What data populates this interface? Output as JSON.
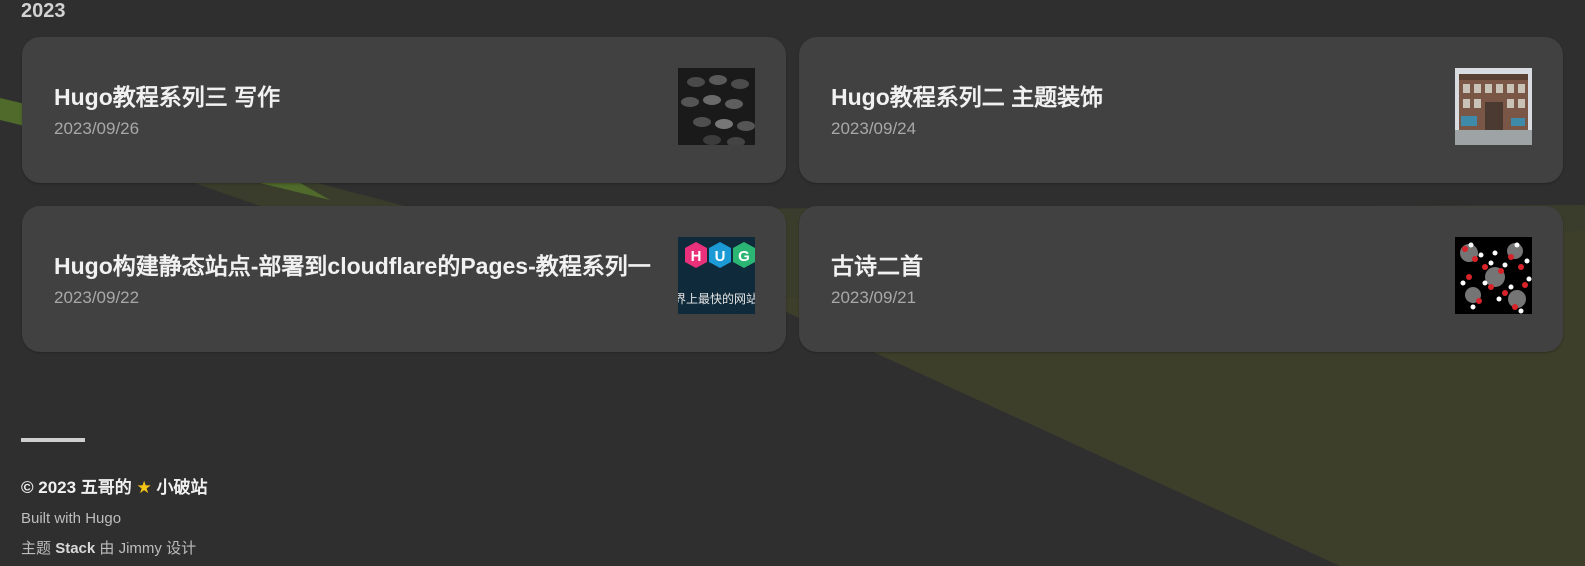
{
  "archive": {
    "year": "2023",
    "articles": [
      {
        "title": "Hugo教程系列三 写作",
        "date": "2023/09/26",
        "thumbnail": "typewriter-keys-image"
      },
      {
        "title": "Hugo教程系列二 主题装饰",
        "date": "2023/09/24",
        "thumbnail": "brick-building-image"
      },
      {
        "title": "Hugo构建静态站点-部署到cloudflare的Pages-教程系列一",
        "date": "2023/09/22",
        "thumbnail": "hugo-logo-image"
      },
      {
        "title": "古诗二首",
        "date": "2023/09/21",
        "thumbnail": "molecules-image"
      }
    ]
  },
  "thumb_hugo": {
    "letters": [
      "H",
      "U",
      "G"
    ],
    "caption": "界上最快的网站"
  },
  "footer": {
    "copyright_prefix": "© 2023 五哥的",
    "copyright_suffix": "小破站",
    "built_prefix": "Built with",
    "built_link": "Hugo",
    "theme_prefix": "主题",
    "theme_name": "Stack",
    "theme_by": "由",
    "theme_author": "Jimmy",
    "theme_suffix": "设计"
  },
  "colors": {
    "background": "#2f2f2f",
    "card": "#414141",
    "accent_green": "#4a5a28",
    "star": "#f5c518"
  }
}
